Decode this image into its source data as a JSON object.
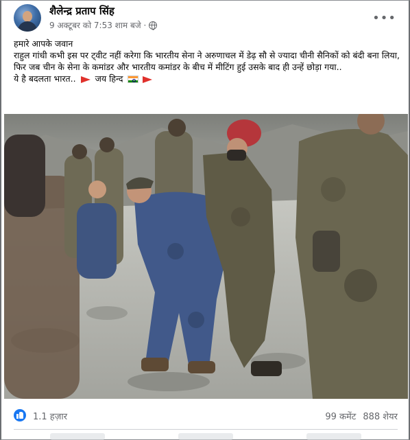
{
  "post": {
    "author": "शैलेन्द्र प्रताप सिंह",
    "timestamp": "9 अक्टूबर को 7:53 शाम बजे ·",
    "text_lines": [
      "हमारे आपके जवान",
      "राहुल गांधी कभी इस पर ट्वीट नहीं करेगा कि भारतीय सेना ने अरुणाचल में डेढ़ सौ से ज्यादा चीनी सैनिकों को बंदी बना लिया, फिर जब चीन के सेना के कमांडर और भारतीय कमांडर के बीच में मीटिंग हुई उसके बाद ही उन्हें छोड़ा गया..",
      "ये है बदलता भारत..",
      "जय हिन्द"
    ],
    "more_icon": "•••"
  },
  "stats": {
    "likes": "1.1 हज़ार",
    "comments": "99 कमेंट",
    "shares": "888 शेयर"
  },
  "icons": {
    "privacy": "globe-icon",
    "reaction": "like-icon",
    "menu": "more-options-icon"
  },
  "colors": {
    "like_blue": "#1877f2",
    "meta_gray": "#65676b",
    "flag_red": "#e0312c"
  }
}
